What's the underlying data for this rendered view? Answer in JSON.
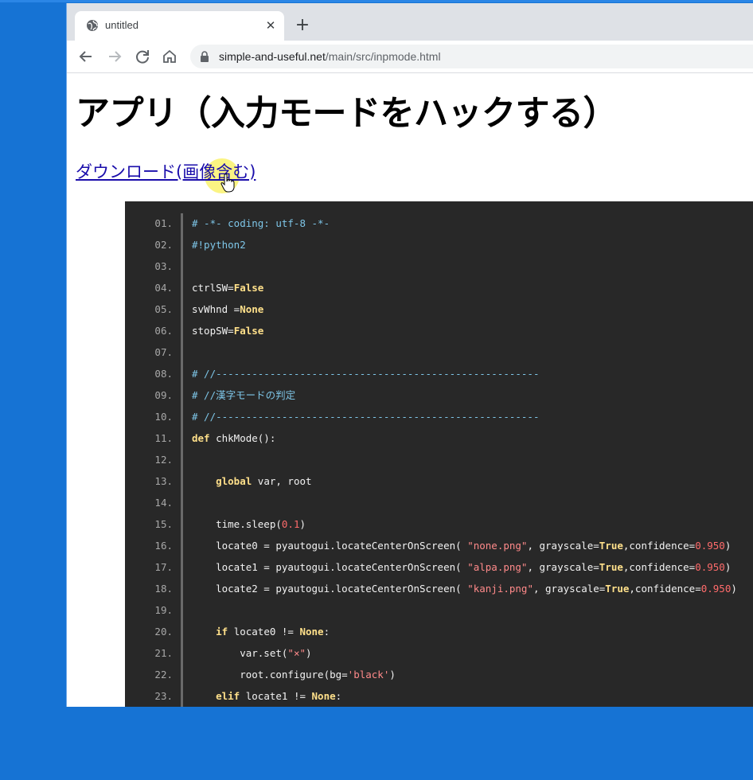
{
  "browser": {
    "tab_title": "untitled",
    "url_host": "simple-and-useful.net",
    "url_path": "/main/src/inpmode.html"
  },
  "page": {
    "title": "アプリ（入力モードをハックする）",
    "download_link": "ダウンロード(画像含む)"
  },
  "code": {
    "line_numbers": [
      "01.",
      "02.",
      "03.",
      "04.",
      "05.",
      "06.",
      "07.",
      "08.",
      "09.",
      "10.",
      "11.",
      "12.",
      "13.",
      "14.",
      "15.",
      "16.",
      "17.",
      "18.",
      "19.",
      "20.",
      "21.",
      "22.",
      "23."
    ],
    "lines": [
      "# -*- coding: utf-8 -*-",
      "#!python2",
      "",
      "ctrlSW=False",
      "svWhnd =None",
      "stopSW=False",
      "",
      "# //------------------------------------------------------",
      "# //漢字モードの判定",
      "# //------------------------------------------------------",
      "def chkMode():",
      "",
      "    global var, root",
      "",
      "    time.sleep(0.1)",
      "    locate0 = pyautogui.locateCenterOnScreen( \"none.png\", grayscale=True,confidence=0.950)",
      "    locate1 = pyautogui.locateCenterOnScreen( \"alpa.png\", grayscale=True,confidence=0.950)",
      "    locate2 = pyautogui.locateCenterOnScreen( \"kanji.png\", grayscale=True,confidence=0.950)",
      "",
      "    if locate0 != None:",
      "        var.set(\"×\")",
      "        root.configure(bg='black')",
      "    elif locate1 != None:"
    ]
  },
  "colors": {
    "desktop": "#1673d4",
    "code_background": "#282828",
    "keyword": "#ffe08a",
    "comment": "#7ec6e8",
    "string": "#ff8a8a",
    "number": "#ff6b6b",
    "link": "#1a0dab"
  },
  "icons": [
    "globe-icon",
    "close-icon",
    "plus-icon",
    "back-arrow-icon",
    "forward-arrow-icon",
    "reload-icon",
    "home-icon",
    "lock-icon",
    "zoom-icon",
    "hand-cursor-icon"
  ]
}
